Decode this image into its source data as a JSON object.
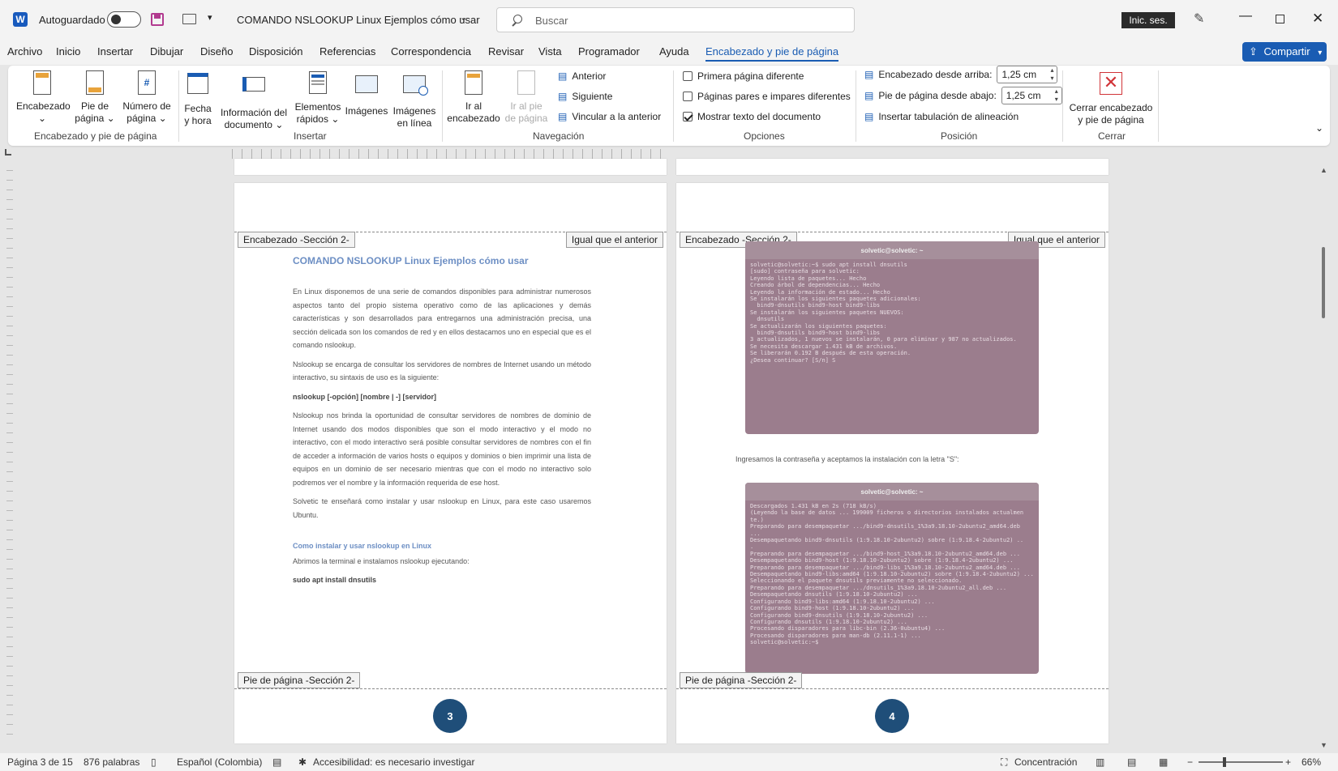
{
  "titlebar": {
    "autosave_label": "Autoguardado",
    "doc_title": "COMANDO NSLOOKUP Linux  Ejemplos cómo usar",
    "search_placeholder": "Buscar",
    "signin_label": "Inic. ses.",
    "share_label": "Compartir"
  },
  "menu": [
    "Archivo",
    "Inicio",
    "Insertar",
    "Dibujar",
    "Diseño",
    "Disposición",
    "Referencias",
    "Correspondencia",
    "Revisar",
    "Vista",
    "Programador",
    "Ayuda",
    "Encabezado y pie de página"
  ],
  "ribbon": {
    "g1": {
      "b1_l1": "Encabezado",
      "b2_l1": "Pie de",
      "b2_l2": "página",
      "b3_l1": "Número de",
      "b3_l2": "página",
      "label": "Encabezado y pie de página"
    },
    "g2": {
      "b1_l1": "Fecha",
      "b1_l2": "y hora",
      "b2_l1": "Información del",
      "b2_l2": "documento",
      "b3_l1": "Elementos",
      "b3_l2": "rápidos",
      "b4_l1": "Imágenes",
      "b5_l1": "Imágenes",
      "b5_l2": "en línea",
      "label": "Insertar"
    },
    "g3": {
      "b1_l1": "Ir al",
      "b1_l2": "encabezado",
      "b2_l1": "Ir al pie",
      "b2_l2": "de página",
      "anterior": "Anterior",
      "siguiente": "Siguiente",
      "vincular": "Vincular a la anterior",
      "label": "Navegación"
    },
    "g4": {
      "opt1": "Primera página diferente",
      "opt2": "Páginas pares e impares diferentes",
      "opt3": "Mostrar texto del documento",
      "label": "Opciones"
    },
    "g5": {
      "hdr_label": "Encabezado desde arriba:",
      "hdr_value": "1,25 cm",
      "ftr_label": "Pie de página desde abajo:",
      "ftr_value": "1,25 cm",
      "tab_label": "Insertar tabulación de alineación",
      "label": "Posición"
    },
    "g6": {
      "b1_l1": "Cerrar encabezado",
      "b1_l2": "y pie de página",
      "label": "Cerrar"
    }
  },
  "pages": {
    "left": {
      "header_tag": "Encabezado -Sección 2-",
      "same_tag": "Igual que el anterior",
      "footer_tag": "Pie de página -Sección 2-",
      "page_number": "3",
      "title": "COMANDO NSLOOKUP Linux  Ejemplos cómo usar",
      "p1": "En Linux disponemos de una serie de comandos disponibles para administrar numerosos aspectos tanto del propio sistema operativo como de las aplicaciones y demás características y son desarrollados para entregarnos una administración precisa, una sección delicada son los comandos de red y en ellos destacamos uno en especial que es el comando nslookup.",
      "p2": "Nslookup se encarga de consultar los servidores de nombres de Internet usando un método interactivo, su sintaxis de uso es la siguiente:",
      "syntax": "nslookup [-opción] [nombre | -] [servidor]",
      "p3": "Nslookup nos brinda la oportunidad de consultar servidores de nombres de dominio de Internet usando dos modos disponibles que son el modo interactivo y el modo no interactivo, con el modo interactivo será posible consultar servidores de nombres con el fin de acceder a  información de varios hosts o equipos y dominios o bien imprimir una lista de equipos en un dominio de ser necesario mientras que con el modo no interactivo solo podremos ver el nombre y la información requerida de ese host.",
      "p4": "Solvetic te enseñará como instalar y usar nslookup en Linux, para este caso usaremos Ubuntu.",
      "h2": "Como instalar y usar nslookup en Linux",
      "p5": "Abrimos la terminal e instalamos nslookup ejecutando:",
      "cmd": "sudo apt install dnsutils"
    },
    "right": {
      "header_tag": "Encabezado -Sección 2-",
      "same_tag": "Igual que el anterior",
      "footer_tag": "Pie de página -Sección 2-",
      "page_number": "4",
      "term1_title": "solvetic@solvetic: ~",
      "term1_text": "solvetic@solvetic:~$ sudo apt install dnsutils\n[sudo] contraseña para solvetic:\nLeyendo lista de paquetes... Hecho\nCreando árbol de dependencias... Hecho\nLeyendo la información de estado... Hecho\nSe instalarán los siguientes paquetes adicionales:\n  bind9-dnsutils bind9-host bind9-libs\nSe instalarán los siguientes paquetes NUEVOS:\n  dnsutils\nSe actualizarán los siguientes paquetes:\n  bind9-dnsutils bind9-host bind9-libs\n3 actualizados, 1 nuevos se instalarán, 0 para eliminar y 987 no actualizados.\nSe necesita descargar 1.431 kB de archivos.\nSe liberarán 0.192 B después de esta operación.\n¿Desea continuar? [S/n] S",
      "caption": "Ingresamos la contraseña y aceptamos la instalación con la letra \"S\":",
      "term2_title": "solvetic@solvetic: ~",
      "term2_text": "Descargados 1.431 kB en 2s (718 kB/s)\n(Leyendo la base de datos ... 199009 ficheros o directorios instalados actualmen\nte.)\nPreparando para desempaquetar .../bind9-dnsutils_1%3a9.18.10-2ubuntu2_amd64.deb\n...\nDesempaquetando bind9-dnsutils (1:9.18.10-2ubuntu2) sobre (1:9.18.4-2ubuntu2) ..\n.\nPreparando para desempaquetar .../bind9-host_1%3a9.18.10-2ubuntu2_amd64.deb ...\nDesempaquetando bind9-host (1:9.18.10-2ubuntu2) sobre (1:9.18.4-2ubuntu2) ...\nPreparando para desempaquetar .../bind9-libs_1%3a9.18.10-2ubuntu2_amd64.deb ...\nDesempaquetando bind9-libs:amd64 (1:9.18.10-2ubuntu2) sobre (1:9.18.4-2ubuntu2) ...\nSeleccionando el paquete dnsutils previamente no seleccionado.\nPreparando para desempaquetar .../dnsutils_1%3a9.18.10-2ubuntu2_all.deb ...\nDesempaquetando dnsutils (1:9.18.10-2ubuntu2) ...\nConfigurando bind9-libs:amd64 (1:9.18.10-2ubuntu2) ...\nConfigurando bind9-host (1:9.18.10-2ubuntu2) ...\nConfigurando bind9-dnsutils (1:9.18.10-2ubuntu2) ...\nConfigurando dnsutils (1:9.18.10-2ubuntu2) ...\nProcesando disparadores para libc-bin (2.36-0ubuntu4) ...\nProcesando disparadores para man-db (2.11.1-1) ...\nsolvetic@solvetic:~$"
    }
  },
  "status": {
    "page": "Página 3 de 15",
    "words": "876 palabras",
    "lang": "Español (Colombia)",
    "access": "Accesibilidad: es necesario investigar",
    "focus": "Concentración",
    "zoom": "66%"
  }
}
